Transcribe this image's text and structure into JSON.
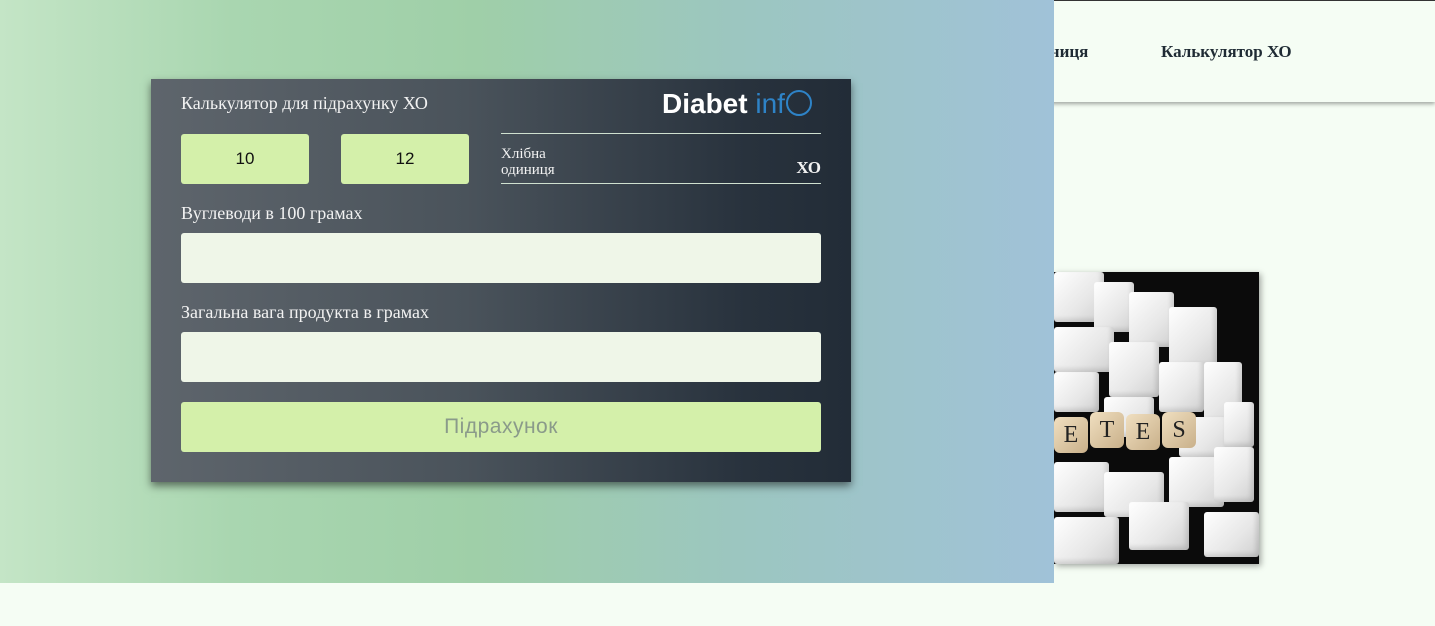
{
  "background_page": {
    "nav": {
      "item_partial": "иниця",
      "item_calculator": "Калькулятор ХО"
    },
    "photo": {
      "dice_letters": [
        "E",
        "T",
        "E",
        "S"
      ]
    }
  },
  "modal": {
    "title": "Калькулятор для підрахунку ХО",
    "logo": {
      "part1": "Diabet",
      "part2": "inf"
    },
    "value_1": "10",
    "value_2": "12",
    "result": {
      "label_line1": "Хлібна",
      "label_line2": "одиниця",
      "unit": "ХО"
    },
    "carbs_field": {
      "label": "Вуглеводи в 100 грамах",
      "value": "",
      "placeholder": ""
    },
    "weight_field": {
      "label": "Загальна вага продукта в грамах",
      "value": "",
      "placeholder": ""
    },
    "calculate_button": "Підрахунок"
  },
  "colors": {
    "accent_green": "#d4f0aa",
    "logo_blue": "#2e83c7",
    "card_dark": "#222c37"
  }
}
